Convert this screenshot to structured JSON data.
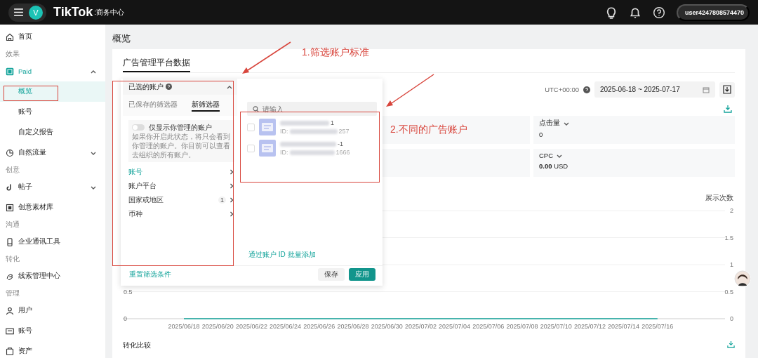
{
  "top_bar": {
    "avatar_letter": "V",
    "logo": "TikTok",
    "logo_suffix": ":商务中心",
    "user": "user4247808574470"
  },
  "sidebar": {
    "items": [
      {
        "kind": "item",
        "label": "首页",
        "selected": false
      },
      {
        "kind": "section",
        "label": "效果"
      },
      {
        "kind": "group",
        "label": "Paid",
        "expanded": true,
        "selected": false
      },
      {
        "kind": "sub",
        "label": "概览",
        "selected": true
      },
      {
        "kind": "sub",
        "label": "账号",
        "selected": false
      },
      {
        "kind": "sub",
        "label": "自定义报告",
        "selected": false
      },
      {
        "kind": "group",
        "label": "自然流量",
        "expanded": false,
        "selected": false
      },
      {
        "kind": "section",
        "label": "创意"
      },
      {
        "kind": "group",
        "label": "帖子",
        "expanded": false,
        "selected": false
      },
      {
        "kind": "item",
        "label": "创意素材库",
        "selected": false
      },
      {
        "kind": "section",
        "label": "沟通"
      },
      {
        "kind": "item",
        "label": "企业通讯工具",
        "selected": false
      },
      {
        "kind": "section",
        "label": "转化"
      },
      {
        "kind": "item",
        "label": "线索管理中心",
        "selected": false
      },
      {
        "kind": "section",
        "label": "管理"
      },
      {
        "kind": "item",
        "label": "用户",
        "selected": false
      },
      {
        "kind": "item",
        "label": "账号",
        "selected": false
      },
      {
        "kind": "item",
        "label": "资产",
        "selected": false
      }
    ]
  },
  "page_title": "概览",
  "card_tab": "广告管理平台数据",
  "timezone": "UTC+00:00",
  "date_range": "2025-06-18 ~ 2025-07-17",
  "metrics": [
    {
      "label": "点击量",
      "value": "0"
    },
    {
      "label": "CPC",
      "value": "**0.00** USD"
    }
  ],
  "chart": {
    "left_axis_labels": [
      "0.5",
      "0"
    ],
    "chart_data": {
      "type": "line",
      "ylabel": "展示次数",
      "categories": [
        "2025/06/18",
        "2025/06/20",
        "2025/06/22",
        "2025/06/24",
        "2025/06/26",
        "2025/06/28",
        "2025/06/30",
        "2025/07/02",
        "2025/07/04",
        "2025/07/06",
        "2025/07/08",
        "2025/07/10",
        "2025/07/12",
        "2025/07/14",
        "2025/07/16"
      ],
      "yticks": [
        0,
        0.5,
        1,
        1.5,
        2
      ],
      "ylim": [
        0,
        2
      ],
      "grid": true,
      "series": [
        {
          "color": "#12a39a",
          "values": [
            0,
            0,
            0,
            0,
            0,
            0,
            0,
            0,
            0,
            0,
            0,
            0,
            0,
            0,
            0
          ]
        }
      ]
    }
  },
  "section_title": "转化比较",
  "filter_popover": {
    "header": "已选的账户",
    "tabs": [
      {
        "label": "已保存的筛选器",
        "selected": false
      },
      {
        "label": "新筛选器",
        "selected": true
      }
    ],
    "toggle": {
      "label": "仅显示你管理的账户",
      "on": false,
      "description": "如果你开启此状态，将只会看到你管理的账户。你目前可以查看去组织的所有账户。"
    },
    "filters": [
      {
        "label": "账号",
        "selected": true
      },
      {
        "label": "账户平台",
        "selected": false
      },
      {
        "label": "国家或地区",
        "count": "1",
        "selected": false
      },
      {
        "label": "币种",
        "selected": false
      }
    ],
    "search": {
      "placeholder": "请输入"
    },
    "accounts": [
      {
        "name_tail": "1",
        "id_prefix": "ID:",
        "id_tail": "257",
        "checked": false
      },
      {
        "name_tail": "-1",
        "id_prefix": "ID:",
        "id_tail": "1666",
        "checked": false
      }
    ],
    "bulk_add_link": "通过账户 ID 批量添加",
    "reset_link": "重置筛选条件",
    "buttons": [
      {
        "label": "保存",
        "kind": "secondary"
      },
      {
        "label": "应用",
        "kind": "primary"
      }
    ]
  },
  "annotations": [
    "1.筛选账户标准",
    "2.不同的广告账户"
  ]
}
